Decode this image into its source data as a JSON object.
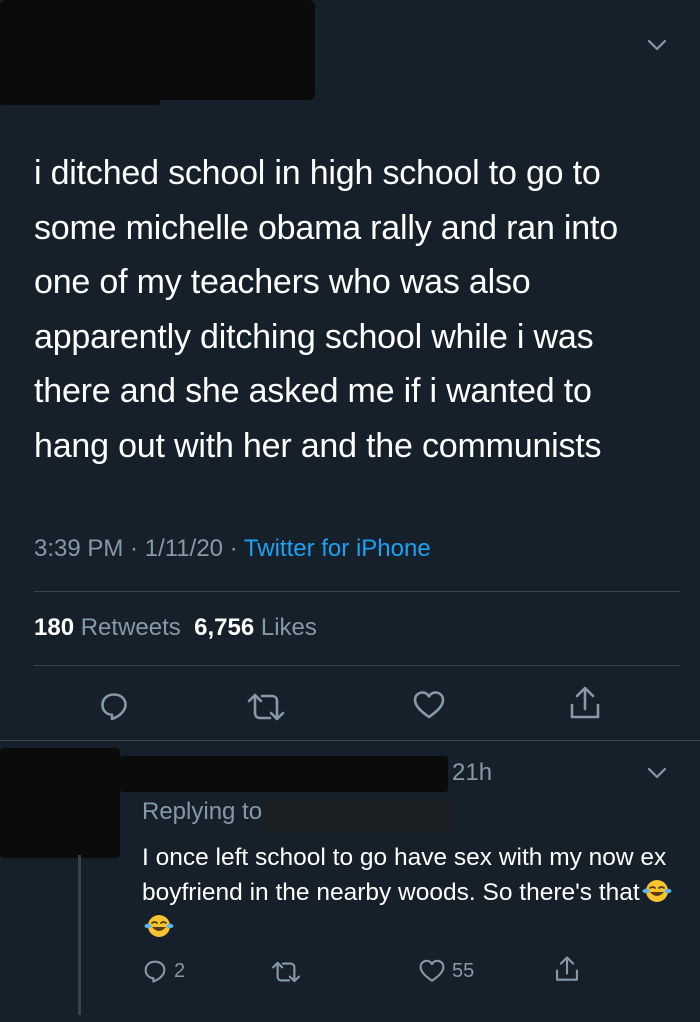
{
  "tweet": {
    "text": "i ditched school in high school to go to some michelle obama rally and ran into one of my teachers who was also apparently ditching school while i was there and she asked me if i wanted to hang out with her and the communists",
    "time": "3:39 PM",
    "date": "1/11/20",
    "separator": " · ",
    "source": "Twitter for iPhone",
    "retweets_count": "180",
    "retweets_label": "Retweets",
    "likes_count": "6,756",
    "likes_label": "Likes"
  },
  "reply": {
    "time": "21h",
    "replying_label": "Replying to",
    "text": "I once left school to go have sex with my now ex boyfriend in the nearby woods. So there's that",
    "reply_count": "2",
    "like_count": "55"
  },
  "icons": {
    "menu": "chevron-down-icon",
    "reply": "reply-icon",
    "retweet": "retweet-icon",
    "like": "heart-icon",
    "share": "share-icon",
    "emoji": "tears-of-joy-emoji"
  },
  "colors": {
    "background": "#15202b",
    "text": "#ffffff",
    "muted": "#8899a6",
    "link": "#1da1f2",
    "divider": "#38444d"
  }
}
